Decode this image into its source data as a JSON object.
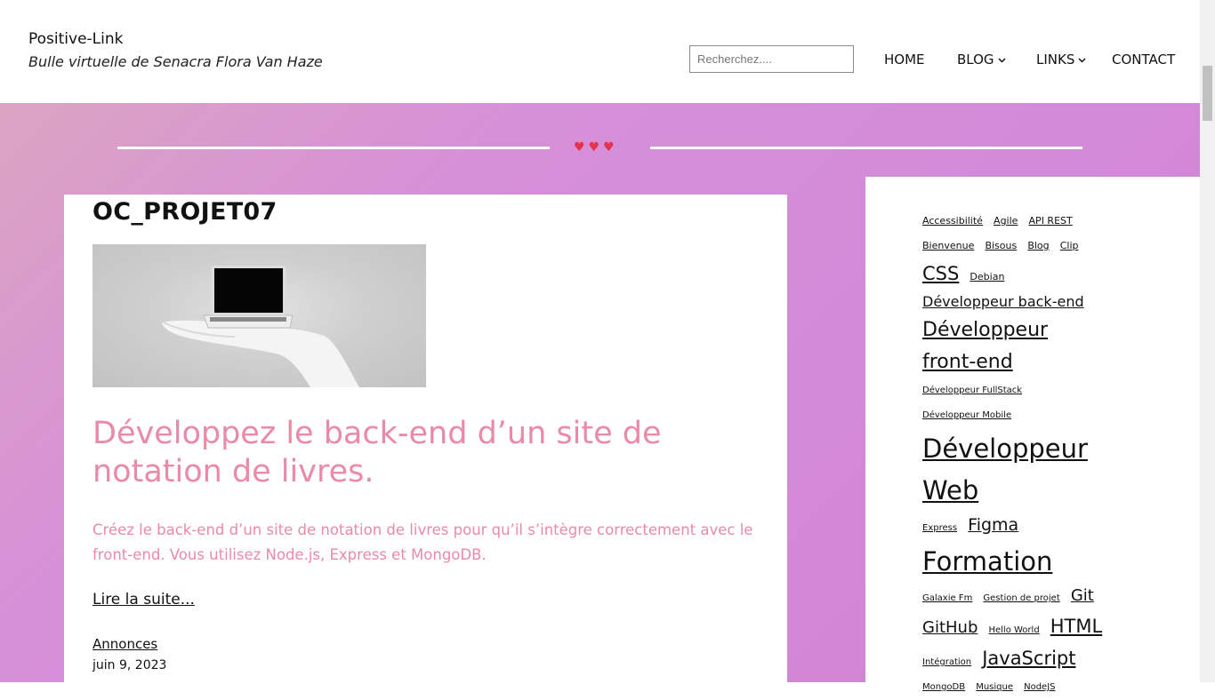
{
  "site": {
    "title": "Positive-Link",
    "tagline": "Bulle virtuelle de Senacra Flora Van Haze"
  },
  "search": {
    "placeholder": "Recherchez...."
  },
  "nav": {
    "home": "HOME",
    "blog": "BLOG",
    "links": "LINKS",
    "contact": "CONTACT"
  },
  "divider": {
    "hearts": "♥♥♥"
  },
  "post": {
    "category_heading": "OC_PROJET07",
    "title": "Développez le back-end d’un site de notation de livres.",
    "excerpt": "Créez le back-end d’un site de notation de livres pour qu’il s’intègre correctement avec le front-end. Vous utilisez Node.js, Express et MongoDB.",
    "read_more": "Lire la suite...",
    "category": "Annonces",
    "date": "juin 9, 2023"
  },
  "tags": [
    {
      "label": "Accessibilité",
      "size": 11
    },
    {
      "label": "Agile",
      "size": 11
    },
    {
      "label": "API REST",
      "size": 11
    },
    {
      "label": "Bienvenue",
      "size": 11
    },
    {
      "label": "Bisous",
      "size": 11
    },
    {
      "label": "Blog",
      "size": 11
    },
    {
      "label": "Clip",
      "size": 11
    },
    {
      "label": "CSS",
      "size": 21
    },
    {
      "label": "Debian",
      "size": 11
    },
    {
      "label": "Développeur back-end",
      "size": 16
    },
    {
      "label": "Développeur front-end",
      "size": 22
    },
    {
      "label": "Développeur FullStack",
      "size": 10
    },
    {
      "label": "Développeur Mobile",
      "size": 10
    },
    {
      "label": "Développeur Web",
      "size": 29
    },
    {
      "label": "Express",
      "size": 10
    },
    {
      "label": "Figma",
      "size": 19
    },
    {
      "label": "Formation",
      "size": 29
    },
    {
      "label": "Galaxie Fm",
      "size": 10
    },
    {
      "label": "Gestion de projet",
      "size": 10
    },
    {
      "label": "Git",
      "size": 18
    },
    {
      "label": "GitHub",
      "size": 18
    },
    {
      "label": "Hello World",
      "size": 10
    },
    {
      "label": "HTML",
      "size": 21
    },
    {
      "label": "Intégration",
      "size": 10
    },
    {
      "label": "JavaScript",
      "size": 21
    },
    {
      "label": "MongoDB",
      "size": 10
    },
    {
      "label": "Musique",
      "size": 10
    },
    {
      "label": "NodeJS",
      "size": 10
    }
  ],
  "colors": {
    "accent_pink": "#ea8aa6",
    "background_gradient_start": "#dba4c2",
    "background_gradient_end": "#d380d2",
    "heart": "#e5324f"
  }
}
